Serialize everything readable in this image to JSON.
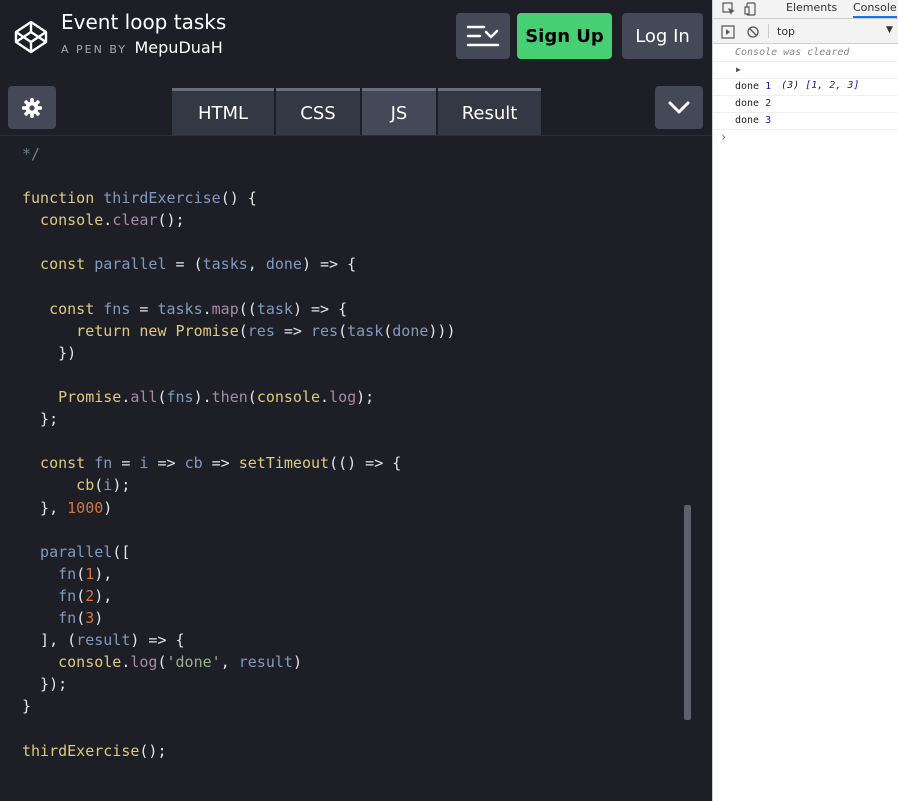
{
  "header": {
    "title": "Event loop tasks",
    "by_label": "A PEN BY",
    "author": "MepuDuaH",
    "signup_label": "Sign Up",
    "login_label": "Log In"
  },
  "tabs": [
    {
      "label": "HTML",
      "active": false
    },
    {
      "label": "CSS",
      "active": false
    },
    {
      "label": "JS",
      "active": true
    },
    {
      "label": "Result",
      "active": false
    }
  ],
  "code_lines": [
    [
      {
        "t": "*/",
        "c": "cm"
      }
    ],
    [],
    [
      {
        "t": "function ",
        "c": "kw"
      },
      {
        "t": "thirdExercise",
        "c": "var"
      },
      {
        "t": "() {",
        "c": "plain"
      }
    ],
    [
      {
        "t": "  console",
        "c": "kw"
      },
      {
        "t": ".",
        "c": "plain"
      },
      {
        "t": "clear",
        "c": "prop"
      },
      {
        "t": "();",
        "c": "plain"
      }
    ],
    [],
    [
      {
        "t": "  const ",
        "c": "kw"
      },
      {
        "t": "parallel",
        "c": "var"
      },
      {
        "t": " = (",
        "c": "plain"
      },
      {
        "t": "tasks",
        "c": "var"
      },
      {
        "t": ", ",
        "c": "plain"
      },
      {
        "t": "done",
        "c": "var"
      },
      {
        "t": ") => {",
        "c": "plain"
      }
    ],
    [],
    [
      {
        "t": "   const ",
        "c": "kw"
      },
      {
        "t": "fns",
        "c": "var"
      },
      {
        "t": " = ",
        "c": "plain"
      },
      {
        "t": "tasks",
        "c": "var"
      },
      {
        "t": ".",
        "c": "plain"
      },
      {
        "t": "map",
        "c": "prop"
      },
      {
        "t": "((",
        "c": "plain"
      },
      {
        "t": "task",
        "c": "var"
      },
      {
        "t": ") => {",
        "c": "plain"
      }
    ],
    [
      {
        "t": "      return new ",
        "c": "kw"
      },
      {
        "t": "Promise",
        "c": "kw"
      },
      {
        "t": "(",
        "c": "plain"
      },
      {
        "t": "res",
        "c": "var"
      },
      {
        "t": " => ",
        "c": "plain"
      },
      {
        "t": "res",
        "c": "var"
      },
      {
        "t": "(",
        "c": "plain"
      },
      {
        "t": "task",
        "c": "var"
      },
      {
        "t": "(",
        "c": "plain"
      },
      {
        "t": "done",
        "c": "var"
      },
      {
        "t": ")))",
        "c": "plain"
      }
    ],
    [
      {
        "t": "    })",
        "c": "plain"
      }
    ],
    [],
    [
      {
        "t": "    Promise",
        "c": "kw"
      },
      {
        "t": ".",
        "c": "plain"
      },
      {
        "t": "all",
        "c": "prop"
      },
      {
        "t": "(",
        "c": "plain"
      },
      {
        "t": "fns",
        "c": "var"
      },
      {
        "t": ").",
        "c": "plain"
      },
      {
        "t": "then",
        "c": "prop"
      },
      {
        "t": "(",
        "c": "plain"
      },
      {
        "t": "console",
        "c": "kw"
      },
      {
        "t": ".",
        "c": "plain"
      },
      {
        "t": "log",
        "c": "prop"
      },
      {
        "t": ");",
        "c": "plain"
      }
    ],
    [
      {
        "t": "  };",
        "c": "plain"
      }
    ],
    [],
    [
      {
        "t": "  const ",
        "c": "kw"
      },
      {
        "t": "fn",
        "c": "var"
      },
      {
        "t": " = ",
        "c": "plain"
      },
      {
        "t": "i",
        "c": "var"
      },
      {
        "t": " => ",
        "c": "plain"
      },
      {
        "t": "cb",
        "c": "var"
      },
      {
        "t": " => ",
        "c": "plain"
      },
      {
        "t": "setTimeout",
        "c": "kw"
      },
      {
        "t": "(() => {",
        "c": "plain"
      }
    ],
    [
      {
        "t": "      cb",
        "c": "kw"
      },
      {
        "t": "(",
        "c": "plain"
      },
      {
        "t": "i",
        "c": "var"
      },
      {
        "t": ");",
        "c": "plain"
      }
    ],
    [
      {
        "t": "  }, ",
        "c": "plain"
      },
      {
        "t": "1000",
        "c": "num"
      },
      {
        "t": ")",
        "c": "plain"
      }
    ],
    [],
    [
      {
        "t": "  parallel",
        "c": "var"
      },
      {
        "t": "([",
        "c": "plain"
      }
    ],
    [
      {
        "t": "    fn",
        "c": "var"
      },
      {
        "t": "(",
        "c": "plain"
      },
      {
        "t": "1",
        "c": "num"
      },
      {
        "t": "),",
        "c": "plain"
      }
    ],
    [
      {
        "t": "    fn",
        "c": "var"
      },
      {
        "t": "(",
        "c": "plain"
      },
      {
        "t": "2",
        "c": "num"
      },
      {
        "t": "),",
        "c": "plain"
      }
    ],
    [
      {
        "t": "    fn",
        "c": "var"
      },
      {
        "t": "(",
        "c": "plain"
      },
      {
        "t": "3",
        "c": "num"
      },
      {
        "t": ")",
        "c": "plain"
      }
    ],
    [
      {
        "t": "  ], (",
        "c": "plain"
      },
      {
        "t": "result",
        "c": "var"
      },
      {
        "t": ") => {",
        "c": "plain"
      }
    ],
    [
      {
        "t": "    console",
        "c": "kw"
      },
      {
        "t": ".",
        "c": "plain"
      },
      {
        "t": "log",
        "c": "prop"
      },
      {
        "t": "(",
        "c": "plain"
      },
      {
        "t": "'done'",
        "c": "str"
      },
      {
        "t": ", ",
        "c": "plain"
      },
      {
        "t": "result",
        "c": "var"
      },
      {
        "t": ")",
        "c": "plain"
      }
    ],
    [
      {
        "t": "  });",
        "c": "plain"
      }
    ],
    [
      {
        "t": "}",
        "c": "plain"
      }
    ],
    [],
    [
      {
        "t": "thirdExercise",
        "c": "kw"
      },
      {
        "t": "();",
        "c": "plain"
      }
    ]
  ],
  "devtools": {
    "tabs": [
      "Elements",
      "Console"
    ],
    "active_tab": "Console",
    "context": "top",
    "messages": {
      "cleared": "Console was cleared",
      "array_count": "(3)",
      "array_values": "[1, 2, 3]",
      "done_label": "done",
      "done_values": [
        "1",
        "2",
        "3"
      ]
    },
    "prompt": "›"
  },
  "colors": {
    "signup": "#47cf73",
    "button_bg": "#444857",
    "editor_bg": "#1e1f26"
  }
}
